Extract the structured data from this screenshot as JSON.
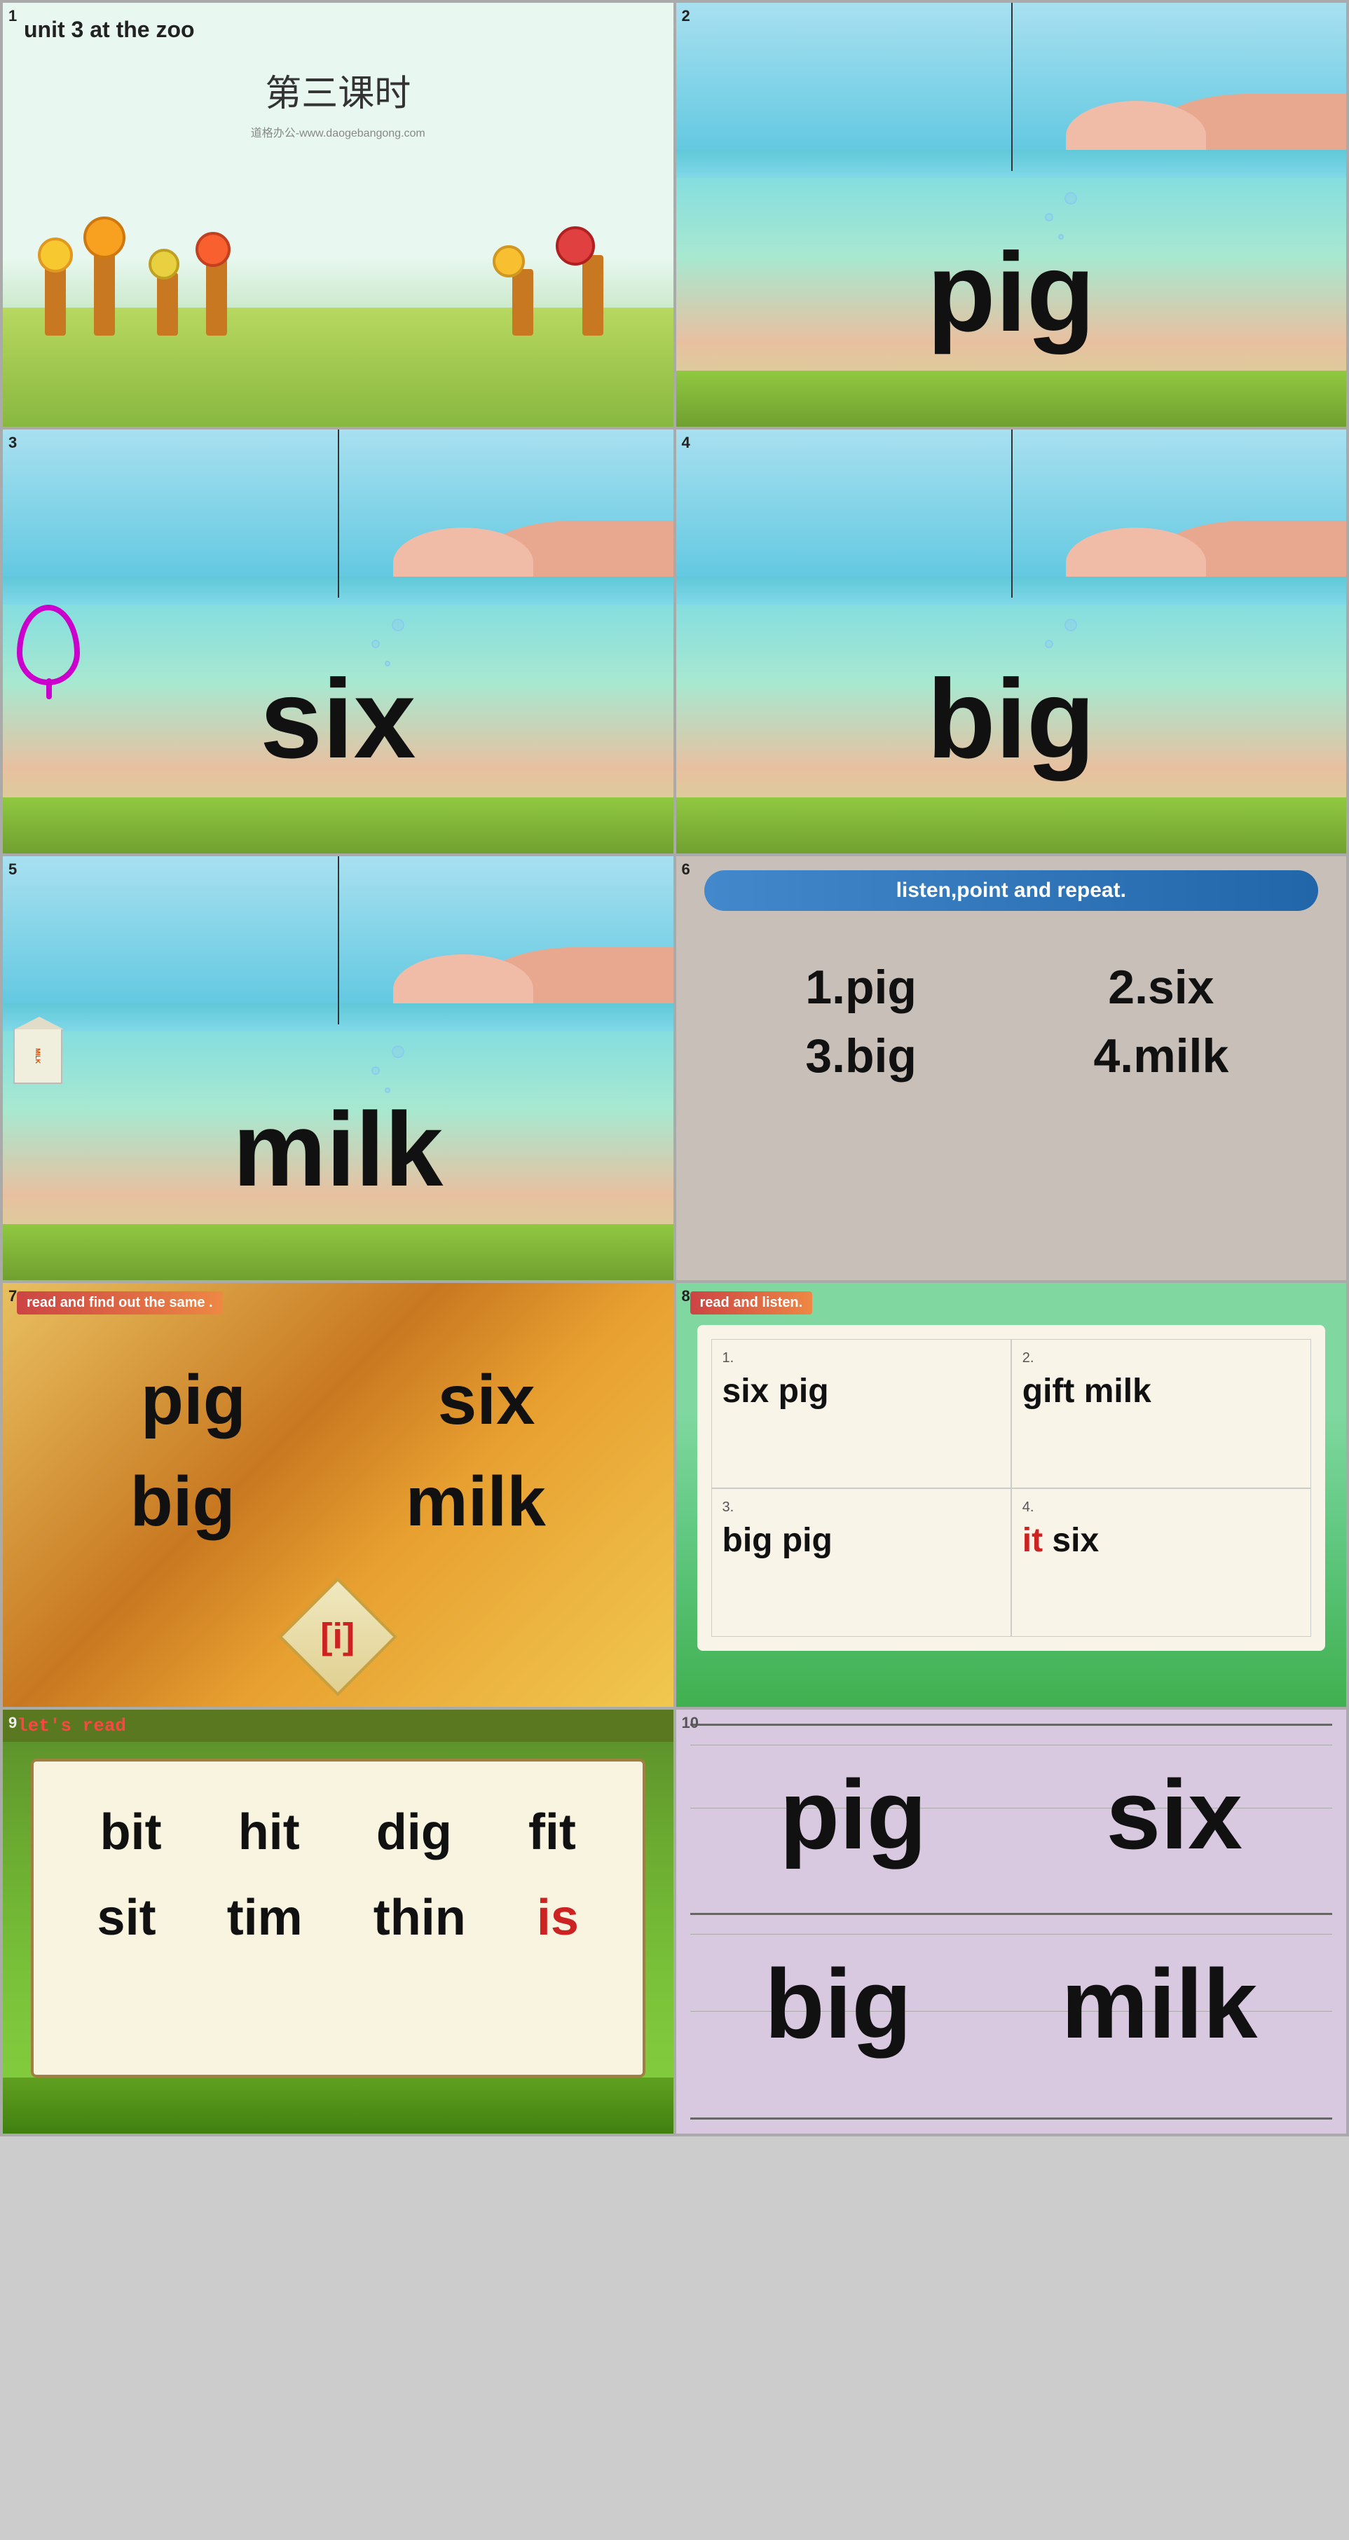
{
  "slides": [
    {
      "id": 1,
      "num": "1",
      "title": "unit 3 at the zoo",
      "subtitle": "第三课时",
      "watermark": "道格办公-www.daogebangong.com"
    },
    {
      "id": 2,
      "num": "2",
      "word": "pig"
    },
    {
      "id": 3,
      "num": "3",
      "word": "six"
    },
    {
      "id": 4,
      "num": "4",
      "word": "big"
    },
    {
      "id": 5,
      "num": "5",
      "word": "milk"
    },
    {
      "id": 6,
      "num": "6",
      "header": "listen,point and repeat.",
      "items": [
        "1.pig",
        "2.six",
        "3.big",
        "4.milk"
      ]
    },
    {
      "id": 7,
      "num": "7",
      "banner": "read and find out the same .",
      "words": [
        "pig",
        "six",
        "big",
        "milk"
      ],
      "phonics": "[i]"
    },
    {
      "id": 8,
      "num": "8",
      "banner": "read and listen.",
      "cells": [
        {
          "num": "1.",
          "words": [
            {
              "text": "six",
              "red": false
            },
            {
              "text": " pig",
              "red": false
            }
          ]
        },
        {
          "num": "2.",
          "words": [
            {
              "text": "gift",
              "red": false
            },
            {
              "text": " milk",
              "red": false
            }
          ]
        },
        {
          "num": "3.",
          "words": [
            {
              "text": "big",
              "red": false
            },
            {
              "text": " pig",
              "red": false
            }
          ]
        },
        {
          "num": "4.",
          "words": [
            {
              "text": "it",
              "red": true
            },
            {
              "text": " six",
              "red": false
            }
          ]
        }
      ]
    },
    {
      "id": 9,
      "num": "9",
      "title": "let's read",
      "words_row1": [
        "bit",
        "hit",
        "dig",
        "fit"
      ],
      "words_row2": [
        "sit",
        "tim",
        "thin",
        "is"
      ],
      "red_word": "is"
    },
    {
      "id": 10,
      "num": "10",
      "words_top": [
        "pig",
        "six"
      ],
      "words_bottom": [
        "big",
        "milk"
      ]
    }
  ]
}
